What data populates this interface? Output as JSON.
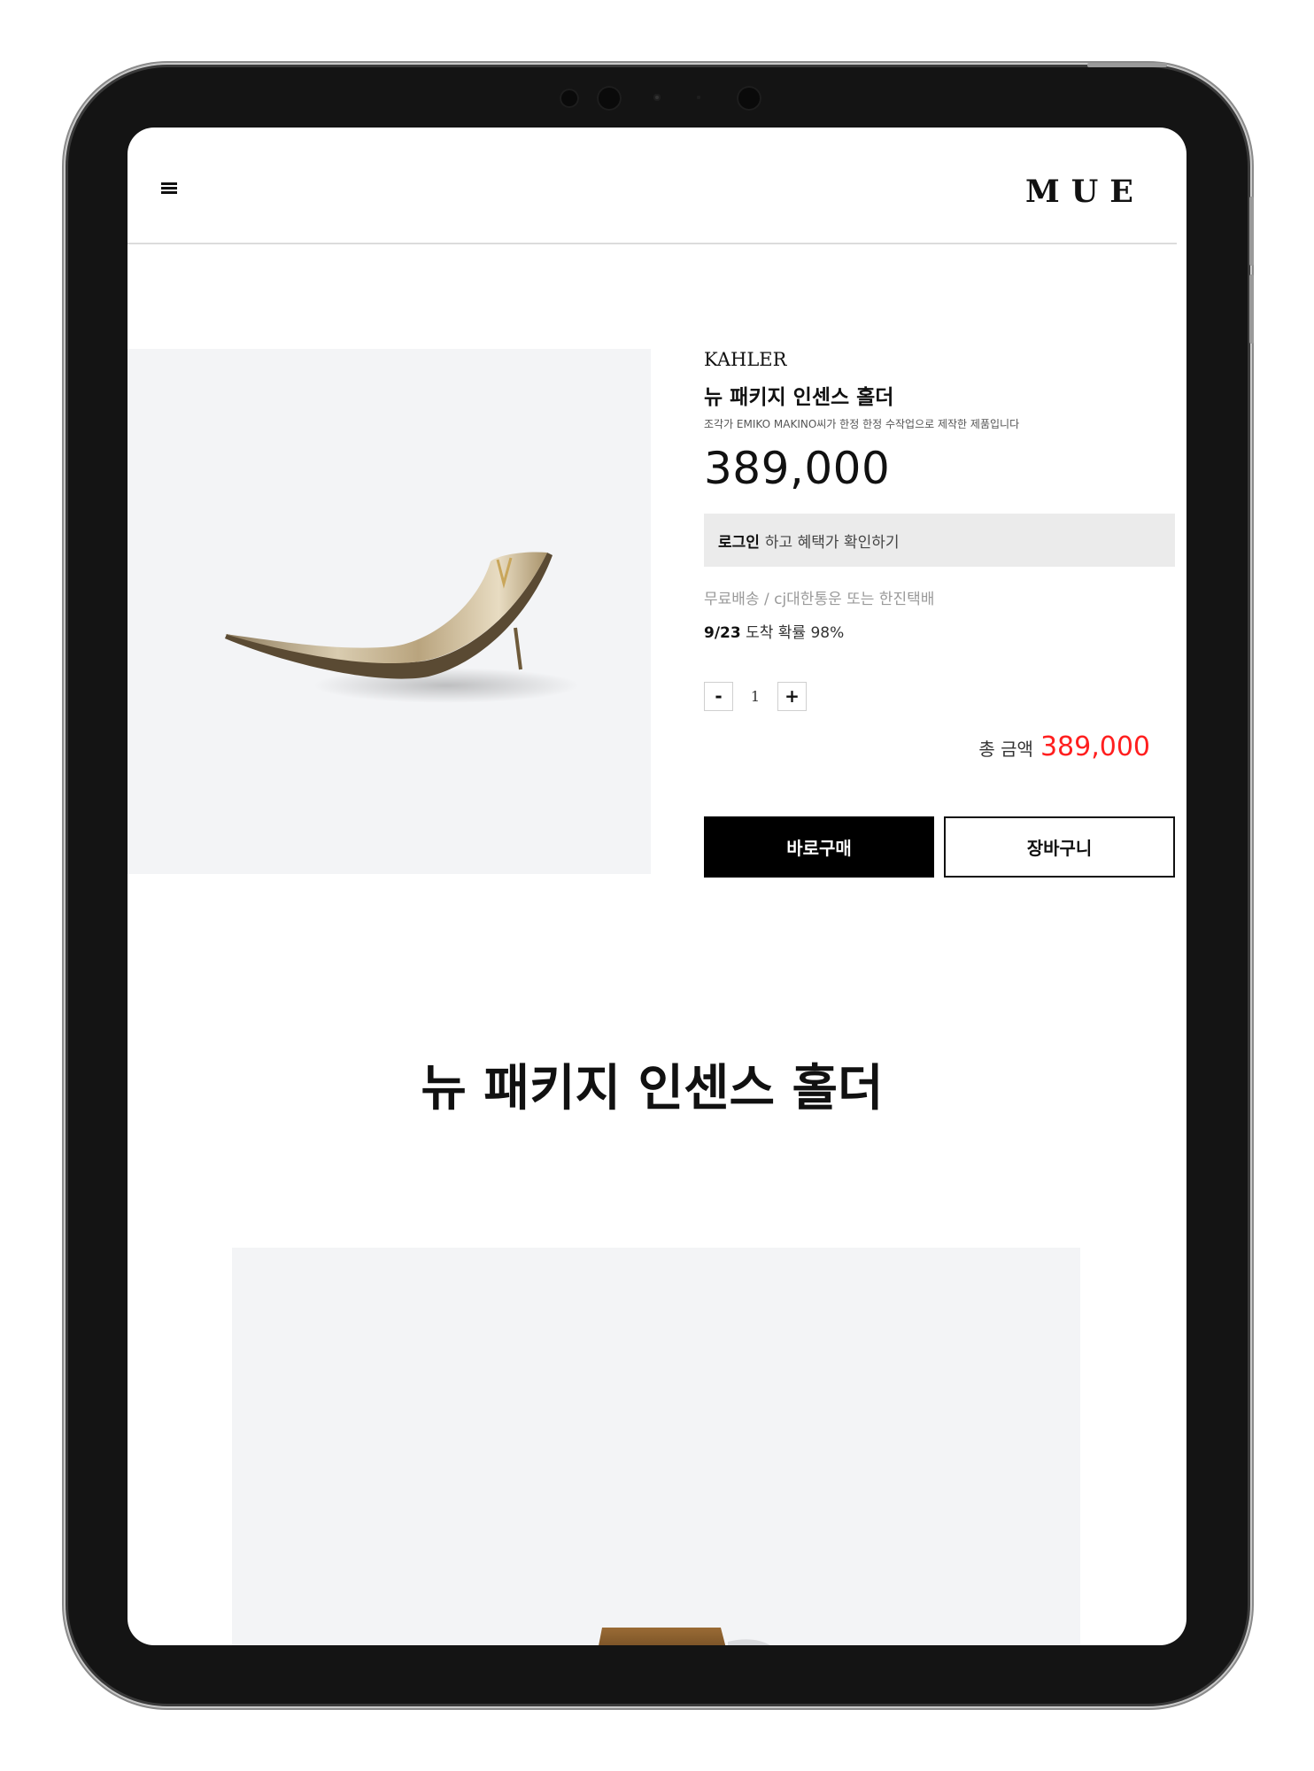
{
  "header": {
    "logo": "MUE",
    "menu_icon": "hamburger-menu-icon"
  },
  "product": {
    "brand": "KAHLER",
    "name": "뉴 패키지 인센스 홀더",
    "description": "조각가 EMIKO MAKINO씨가 한정 한정 수작업으로 제작한 제품입니다",
    "price": "389,000",
    "login_strong": "로그인",
    "login_text": "하고 혜택가 확인하기",
    "shipping": "무료배송 / cj대한통운 또는 한진택배",
    "eta_date": "9/23",
    "eta_text": "도착 확률 98%",
    "quantity": {
      "minus_label": "-",
      "value": "1",
      "plus_label": "+"
    },
    "total_label": "총 금액",
    "total_amount": "389,000",
    "buy_label": "바로구매",
    "cart_label": "장바구니"
  },
  "detail": {
    "title": "뉴 패키지 인센스 홀더"
  },
  "colors": {
    "accent_price": "#ff1f1f",
    "buy_button": "#000000",
    "image_background": "#f3f4f6"
  }
}
